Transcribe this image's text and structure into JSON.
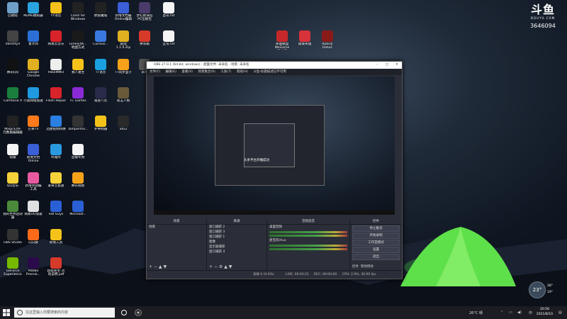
{
  "desktop": {
    "icons_col1": [
      {
        "label": "回收站",
        "color": "#6fa0c8",
        "icon": "recycle-bin-icon"
      },
      {
        "label": "IdentityV",
        "color": "#444",
        "icon": "identity-v-icon"
      },
      {
        "label": "腾讯QQ",
        "color": "#111",
        "icon": "qq-icon"
      },
      {
        "label": "Camtasia 9",
        "color": "#1a7f3c",
        "icon": "camtasia-icon"
      },
      {
        "label": "MagicEXIF\n元数据编辑器",
        "color": "#222",
        "icon": "magicexif-icon"
      },
      {
        "label": "萌娘",
        "color": "#f5f5f5",
        "icon": "mascot-icon"
      },
      {
        "label": "QQ音乐",
        "color": "#f5d13a",
        "icon": "qq-music-icon"
      },
      {
        "label": "我的世界启动器",
        "color": "#4b8a3a",
        "icon": "minecraft-icon"
      },
      {
        "label": "OBS Studio",
        "color": "#333",
        "icon": "obs-icon"
      },
      {
        "label": "GeForce\nExperience",
        "color": "#76b900",
        "icon": "geforce-icon"
      }
    ],
    "icons_col2": [
      {
        "label": "MuMu模拟器",
        "color": "#2aa3e0",
        "icon": "mumu-icon"
      },
      {
        "label": "鲁大师",
        "color": "#2b6fd6",
        "icon": "ludashi-icon"
      },
      {
        "label": "Google\nChrome",
        "color": "#e0b020",
        "icon": "chrome-icon"
      },
      {
        "label": "小黑网络加速",
        "color": "#1f9ae0",
        "icon": "accelerator-icon"
      },
      {
        "label": "芒果TV",
        "color": "#ff7a1a",
        "icon": "mango-tv-icon"
      },
      {
        "label": "新增文档\nOnline",
        "color": "#3a5fd6",
        "icon": "doc-online-icon"
      },
      {
        "label": "新增奖励编\n工具",
        "color": "#e85aa0",
        "icon": "award-tool-icon"
      },
      {
        "label": "网易UU加速",
        "color": "#e0e0e0",
        "icon": "uu-icon"
      },
      {
        "label": "向日葵",
        "color": "#ff6a1a",
        "icon": "sunflower-icon"
      },
      {
        "label": "Adobe\nPremie...",
        "color": "#2a0a4a",
        "icon": "premiere-icon"
      }
    ],
    "icons_col3": [
      {
        "label": "YY语音",
        "color": "#f5c21a",
        "icon": "yy-icon"
      },
      {
        "label": "网易云音乐",
        "color": "#d8232a",
        "icon": "netease-music-icon"
      },
      {
        "label": "PokeMMO",
        "color": "#eee",
        "icon": "pokemmo-icon"
      },
      {
        "label": "Flash Repair",
        "color": "#d8232a",
        "icon": "flash-repair-icon"
      },
      {
        "label": "迅捷视频转换",
        "color": "#2a7fe0",
        "icon": "video-convert-icon"
      },
      {
        "label": "哔哩哔",
        "color": "#2a9ae0",
        "icon": "bilibili-icon"
      },
      {
        "label": "爱奇艺极速",
        "color": "#f5d13a",
        "icon": "iqiyi-icon"
      },
      {
        "label": "Fall Guys",
        "color": "#2a5fd6",
        "icon": "fall-guys-icon"
      },
      {
        "label": "新增工具",
        "color": "#f5c21a",
        "icon": "tool-icon"
      },
      {
        "label": "超级新生-活\n动说明.pdf",
        "color": "#d83a2a",
        "icon": "pdf-icon"
      }
    ],
    "icons_col4": [
      {
        "label": "Clash for\nWindows",
        "color": "#222",
        "icon": "clash-icon"
      },
      {
        "label": "LonelyWi...\n地图方式",
        "color": "#1a1a1a",
        "icon": "lonely-icon"
      },
      {
        "label": "我人重生",
        "color": "#f5c21a",
        "icon": "rebirth-icon"
      },
      {
        "label": "TC Games",
        "color": "#8a2ad6",
        "icon": "tc-games-icon"
      },
      {
        "label": "Tampermo...",
        "color": "#333",
        "icon": "tampermonkey-icon"
      },
      {
        "label": "直播专用",
        "color": "#f5f5f5",
        "icon": "live-icon"
      },
      {
        "label": "腾讯视频",
        "color": "#f5a21a",
        "icon": "tencent-video-icon"
      },
      {
        "label": "Microsof...",
        "color": "#2a5fd6",
        "icon": "word-icon"
      }
    ],
    "icons_col5": [
      {
        "label": "野狼魔城",
        "color": "#222",
        "icon": "wolf-icon"
      },
      {
        "label": "Curious...",
        "color": "#3a7ae0",
        "icon": "curious-icon"
      },
      {
        "label": "TT语音",
        "color": "#1aa0e0",
        "icon": "tt-icon"
      },
      {
        "label": "鬼谷八荒",
        "color": "#2a2a4a",
        "icon": "ghost-icon"
      },
      {
        "label": "罗导网器",
        "color": "#f5c21a",
        "icon": "folder-icon"
      }
    ],
    "icons_col6": [
      {
        "label": "新增文档编\nOnline编辑",
        "color": "#3a5fd6",
        "icon": "doc-icon"
      },
      {
        "label": "驱动\n1.1.0.Zip",
        "color": "#e0b020",
        "icon": "zip-icon"
      },
      {
        "label": "TT同步盒子",
        "color": "#f5a21a",
        "icon": "sync-box-icon"
      },
      {
        "label": "第五人格",
        "color": "#6a5a3a",
        "icon": "fifth-icon"
      },
      {
        "label": "SIG2",
        "color": "#2a2a2a",
        "icon": "sig-icon"
      }
    ],
    "icons_col7": [
      {
        "label": "梦幻新诛仙\nPC压缩包",
        "color": "#4a3a6a",
        "icon": "game-icon"
      },
      {
        "label": "拼装箱",
        "color": "#d83a2a",
        "icon": "box-icon"
      },
      {
        "label": "米哈",
        "color": "#555",
        "icon": "mihoyo-icon"
      }
    ],
    "icons_col8": [
      {
        "label": "直号.txt",
        "color": "#f5f5f5",
        "icon": "txt-icon"
      },
      {
        "label": "宜号.txt",
        "color": "#f5f5f5",
        "icon": "txt-icon"
      }
    ],
    "float_icons": [
      {
        "label": "英雄联盟WeGame\n版大厅",
        "color": "#c8282a",
        "icon": "lol-icon"
      },
      {
        "label": "雷锋英雄",
        "color": "#d8323a",
        "icon": "hero-icon"
      },
      {
        "label": "Rubick\nDota2",
        "color": "#8a1a1a",
        "icon": "dota-icon"
      }
    ]
  },
  "douyu": {
    "logo": "斗鱼",
    "sub": "DOUYU.COM",
    "room": "3646094"
  },
  "obs": {
    "title": "OBS 27.0.1 (64-bit, windows) - 配置文件: 未命名 - 场景: 未命名",
    "menu": [
      "文件(F)",
      "编辑(E)",
      "查看(V)",
      "场景集合(S)",
      "工具(T)",
      "帮助(H)",
      "斗鱼-标题描述已不可用"
    ],
    "preview_text": "头条平台开播成功",
    "docks": {
      "scenes": {
        "title": "场景",
        "items": [
          "场景"
        ]
      },
      "sources": {
        "title": "来源",
        "items": [
          "窗口捕获 2",
          "窗口捕获 3",
          "窗口捕获 1",
          "图像",
          "显示器捕获",
          "窗口捕获 4"
        ]
      },
      "mixer": {
        "title": "音频混音",
        "items": [
          "桌面音频",
          "麦克风/Aux"
        ]
      },
      "controls": {
        "title": "控件",
        "buttons": [
          "停止推流",
          "开始录制",
          "工作室模式",
          "设置",
          "退出"
        ],
        "tabs": [
          "控件",
          "转场特效"
        ]
      }
    },
    "status": {
      "drop": "丢帧 0 (0.0%)",
      "live": "LIVE: 00:03:21",
      "rec": "REC: 00:00:00",
      "cpu": "CPU: 2.9%, 30.00 fps"
    }
  },
  "weather": {
    "temp": "23°",
    "hi": "28°",
    "lo": "19°"
  },
  "taskbar": {
    "search_placeholder": "在这里输入你要搜索的内容",
    "tray_temp": "26°C 晴",
    "ime": "中",
    "time": "20:56",
    "date": "2021/8/10"
  }
}
